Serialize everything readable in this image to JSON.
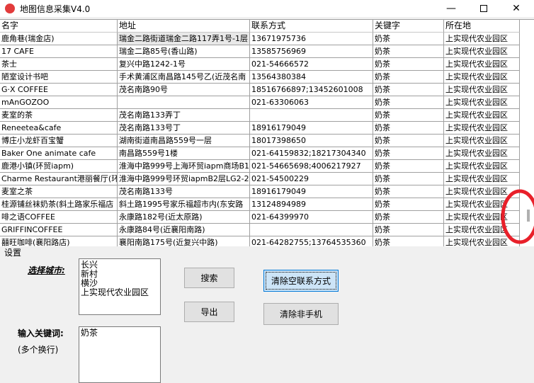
{
  "window": {
    "title": "地图信息采集V4.0",
    "icon_label": "DX"
  },
  "table": {
    "columns": [
      "名字",
      "地址",
      "联系方式",
      "关键字",
      "所在地"
    ],
    "rows": [
      [
        "鹿角巷(瑞金店)",
        "瑞金二路街道瑞金二路117弄1号-1层",
        "13671975736",
        "奶茶",
        "上实现代农业园区"
      ],
      [
        "17 CAFE",
        "瑞金二路85号(香山路)",
        "13585756969",
        "奶茶",
        "上实现代农业园区"
      ],
      [
        "茶士",
        "复兴中路1242-1号",
        "021-54666572",
        "奶茶",
        "上实现代农业园区"
      ],
      [
        "陋室设计书吧",
        "手术黄浦区南昌路145号乙(近茂名南",
        "13564380384",
        "奶茶",
        "上实现代农业园区"
      ],
      [
        "G·X COFFEE",
        "茂名南路90号",
        "18516766897;13452601008",
        "奶茶",
        "上实现代农业园区"
      ],
      [
        "mAnGOZOO",
        "",
        "021-63306063",
        "奶茶",
        "上实现代农业园区"
      ],
      [
        "麦室的茶",
        "茂名南路133弄丁",
        "",
        "奶茶",
        "上实现代农业园区"
      ],
      [
        "Reneetea&cafe",
        "茂名南路133号丁",
        "18916179049",
        "奶茶",
        "上实现代农业园区"
      ],
      [
        "博庄小龙虾百宝蟹",
        "湖南街道南昌路559号一层",
        "18017398650",
        "奶茶",
        "上实现代农业园区"
      ],
      [
        "Baker One animate cafe",
        "南昌路559号1楼",
        "021-64159832;18217304340",
        "奶茶",
        "上实现代农业园区"
      ],
      [
        "鹿港小镇(环贸iapm)",
        "淮海中路999号上海环贸iapm商场B1",
        "021-54665698;4006217927",
        "奶茶",
        "上实现代农业园区"
      ],
      [
        "Charme Restaurant港丽餐厅(环贸",
        "淮海中路999号环贸iapmB2层LG2-22",
        "021-54500229",
        "奶茶",
        "上实现代农业园区"
      ],
      [
        "麦室之茶",
        "茂名南路133号",
        "18916179049",
        "奶茶",
        "上实现代农业园区"
      ],
      [
        "桂源铺丝袜奶茶(斜土路家乐福店",
        "斜土路1995号家乐福超市内(东安路",
        "13124894989",
        "奶茶",
        "上实现代农业园区"
      ],
      [
        "啡之语COFFEE",
        "永康路182号(近太原路)",
        "021-64399970",
        "奶茶",
        "上实现代农业园区"
      ],
      [
        "GRIFFINCOFFEE",
        "永康路84号(近襄阳南路)",
        "",
        "奶茶",
        "上实现代农业园区"
      ],
      [
        "囍旺咖啡(襄阳路店)",
        "襄阳南路175号(近复兴中路)",
        "021-64282755;13764535360",
        "奶茶",
        "上实现代农业园区"
      ]
    ]
  },
  "settings": {
    "group_label": "设置",
    "city_label": "选择城市:",
    "cities": "长兴\n新村\n横沙\n上实现代农业园区",
    "keyword_label": "输入关键词:",
    "keyword_hint": "(多个换行)",
    "keywords": "奶茶",
    "search_button": "搜索",
    "export_button": "导出",
    "clear_empty_button": "清除空联系方式",
    "clear_nonmobile_button": "清除非手机"
  },
  "colors": {
    "annotation": "#e8202a",
    "focus": "#0078d7"
  }
}
